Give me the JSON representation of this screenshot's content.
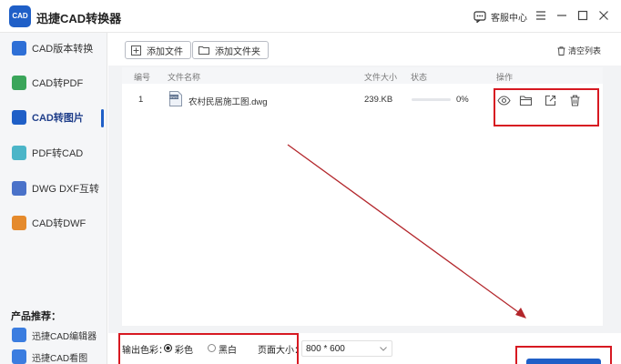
{
  "app": {
    "logo_text": "CAD",
    "title": "迅捷CAD转换器",
    "service_label": "客服中心"
  },
  "sidebar": {
    "items": [
      {
        "label": "CAD版本转换",
        "icon": "cad-version-icon",
        "color": "#2e6fd6"
      },
      {
        "label": "CAD转PDF",
        "icon": "cad-pdf-icon",
        "color": "#3aa55a"
      },
      {
        "label": "CAD转图片",
        "icon": "cad-image-icon",
        "color": "#1f5fc7"
      },
      {
        "label": "PDF转CAD",
        "icon": "pdf-cad-icon",
        "color": "#4bb5c8"
      },
      {
        "label": "DWG DXF互转",
        "icon": "dwg-dxf-icon",
        "color": "#4a72c9"
      },
      {
        "label": "CAD转DWF",
        "icon": "cad-dwf-icon",
        "color": "#e58a2c"
      }
    ],
    "active_index": 2,
    "recommend_title": "产品推荐：",
    "recommend": [
      {
        "label": "迅捷CAD编辑器"
      },
      {
        "label": "迅捷CAD看图"
      }
    ]
  },
  "toolbar": {
    "add_file": "添加文件",
    "add_folder": "添加文件夹",
    "clear_list": "清空列表"
  },
  "table": {
    "headers": {
      "index": "编号",
      "name": "文件名称",
      "size": "文件大小",
      "status": "状态",
      "actions": "操作"
    },
    "rows": [
      {
        "index": "1",
        "name": "农村民居施工图.dwg",
        "size": "239.KB",
        "progress": 0,
        "progress_text": "0%",
        "file_icon_text": "DWG"
      }
    ]
  },
  "settings": {
    "color_label": "输出色彩：",
    "color_option_color": "彩色",
    "color_option_bw": "黑白",
    "color_selected": "彩色",
    "size_label": "页面大小：",
    "size_value": "800 * 600"
  },
  "colors": {
    "accent": "#1f5fc7",
    "annotation": "#d71921"
  }
}
